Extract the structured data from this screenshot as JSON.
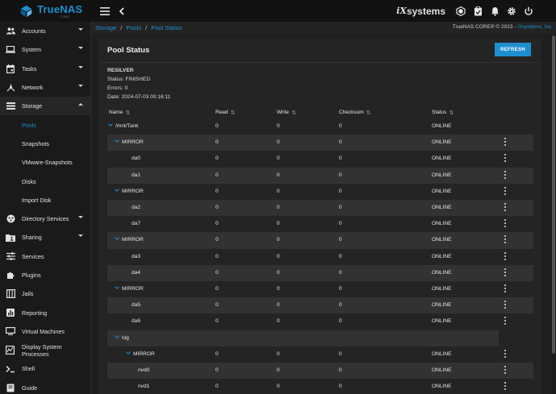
{
  "app": {
    "name": "TrueNAS",
    "edition": "CORE"
  },
  "topbar": {
    "vendor_prefix": "iX",
    "vendor_name": "systems"
  },
  "sidebar": {
    "items": [
      {
        "label": "Accounts",
        "icon": "people-icon",
        "expandable": true
      },
      {
        "label": "System",
        "icon": "laptop-icon",
        "expandable": true
      },
      {
        "label": "Tasks",
        "icon": "calendar-icon",
        "expandable": true
      },
      {
        "label": "Network",
        "icon": "network-icon",
        "expandable": true
      },
      {
        "label": "Storage",
        "icon": "storage-icon",
        "expandable": true,
        "expanded": true
      },
      {
        "label": "Pools",
        "sub": true,
        "selected": true
      },
      {
        "label": "Snapshots",
        "sub": true
      },
      {
        "label": "VMware-Snapshots",
        "sub": true
      },
      {
        "label": "Disks",
        "sub": true
      },
      {
        "label": "Import Disk",
        "sub": true
      },
      {
        "label": "Directory Services",
        "icon": "directory-icon",
        "expandable": true
      },
      {
        "label": "Sharing",
        "icon": "folder-share-icon",
        "expandable": true
      },
      {
        "label": "Services",
        "icon": "tune-icon"
      },
      {
        "label": "Plugins",
        "icon": "puzzle-icon"
      },
      {
        "label": "Jails",
        "icon": "jail-icon"
      },
      {
        "label": "Reporting",
        "icon": "chart-icon"
      },
      {
        "label": "Virtual Machines",
        "icon": "computer-icon"
      },
      {
        "label": "Display System Processes",
        "icon": "processes-icon"
      },
      {
        "label": "Shell",
        "icon": "terminal-icon"
      },
      {
        "label": "Guide",
        "icon": "book-icon"
      }
    ]
  },
  "breadcrumb": {
    "items": [
      "Storage",
      "Pools",
      "Pool Status"
    ],
    "separator": "/"
  },
  "copyright": {
    "text": "TrueNAS CORE® © 2023 - ",
    "brand": "iXsystems, Inc."
  },
  "card": {
    "title": "Pool Status",
    "refresh_label": "REFRESH"
  },
  "resilver": {
    "title": "RESILVER",
    "status": "Status: FINISHED",
    "errors": "Errors: 0",
    "date": "Date: 2024-07-03 00:16:11"
  },
  "table": {
    "columns": [
      "Name",
      "Read",
      "Write",
      "Checksum",
      "Status"
    ],
    "rows": [
      {
        "name": "/mnt/Tank",
        "level": 0,
        "expander": true,
        "read": "0",
        "write": "0",
        "checksum": "0",
        "status": "ONLINE",
        "menu": false
      },
      {
        "name": "MIRROR",
        "level": 1,
        "expander": true,
        "read": "0",
        "write": "0",
        "checksum": "0",
        "status": "ONLINE",
        "menu": true
      },
      {
        "name": "da0",
        "level": 2,
        "expander": false,
        "read": "0",
        "write": "0",
        "checksum": "0",
        "status": "ONLINE",
        "menu": true
      },
      {
        "name": "da1",
        "level": 2,
        "expander": false,
        "read": "0",
        "write": "0",
        "checksum": "0",
        "status": "ONLINE",
        "menu": true
      },
      {
        "name": "MIRROR",
        "level": 1,
        "expander": true,
        "read": "0",
        "write": "0",
        "checksum": "0",
        "status": "ONLINE",
        "menu": true
      },
      {
        "name": "da2",
        "level": 2,
        "expander": false,
        "read": "0",
        "write": "0",
        "checksum": "0",
        "status": "ONLINE",
        "menu": true
      },
      {
        "name": "da7",
        "level": 2,
        "expander": false,
        "read": "0",
        "write": "0",
        "checksum": "0",
        "status": "ONLINE",
        "menu": true
      },
      {
        "name": "MIRROR",
        "level": 1,
        "expander": true,
        "read": "0",
        "write": "0",
        "checksum": "0",
        "status": "ONLINE",
        "menu": true
      },
      {
        "name": "da3",
        "level": 2,
        "expander": false,
        "read": "0",
        "write": "0",
        "checksum": "0",
        "status": "ONLINE",
        "menu": true
      },
      {
        "name": "da4",
        "level": 2,
        "expander": false,
        "read": "0",
        "write": "0",
        "checksum": "0",
        "status": "ONLINE",
        "menu": true
      },
      {
        "name": "MIRROR",
        "level": 1,
        "expander": true,
        "read": "0",
        "write": "0",
        "checksum": "0",
        "status": "ONLINE",
        "menu": true
      },
      {
        "name": "da5",
        "level": 2,
        "expander": false,
        "read": "0",
        "write": "0",
        "checksum": "0",
        "status": "ONLINE",
        "menu": true
      },
      {
        "name": "da6",
        "level": 2,
        "expander": false,
        "read": "0",
        "write": "0",
        "checksum": "0",
        "status": "ONLINE",
        "menu": true
      },
      {
        "name": "log",
        "level": 1,
        "expander": true,
        "read": "",
        "write": "",
        "checksum": "",
        "status": "",
        "menu": false
      },
      {
        "name": "MIRROR",
        "level": 2,
        "expander": true,
        "read": "0",
        "write": "0",
        "checksum": "0",
        "status": "ONLINE",
        "menu": true
      },
      {
        "name": "nvd0",
        "level": 3,
        "expander": false,
        "read": "0",
        "write": "0",
        "checksum": "0",
        "status": "ONLINE",
        "menu": true
      },
      {
        "name": "nvd1",
        "level": 3,
        "expander": false,
        "read": "0",
        "write": "0",
        "checksum": "0",
        "status": "ONLINE",
        "menu": true
      }
    ]
  },
  "colors": {
    "accent": "#1d8fd1",
    "background": "#1e1e1e",
    "card": "#242424",
    "row_alt": "#323232"
  }
}
